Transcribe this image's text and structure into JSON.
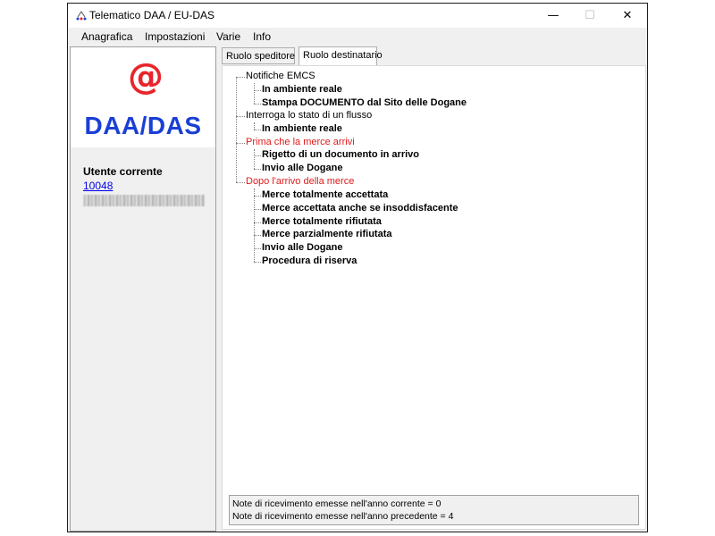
{
  "window": {
    "title": "Telematico DAA / EU-DAS",
    "controls": {
      "minimize": "—",
      "maximize": "☐",
      "close": "✕"
    }
  },
  "menu": [
    {
      "label": "Anagrafica"
    },
    {
      "label": "Impostazioni"
    },
    {
      "label": "Varie"
    },
    {
      "label": "Info"
    }
  ],
  "sidebar": {
    "logo_symbol": "@",
    "logo_text": "DAA/DAS",
    "user_label": "Utente corrente",
    "user_id": "10048"
  },
  "tabs": [
    {
      "label": "Ruolo speditore",
      "active": false
    },
    {
      "label": "Ruolo destinatario",
      "active": true
    }
  ],
  "tree": [
    {
      "label": "Notifiche EMCS",
      "color": "#000000",
      "children": [
        "In ambiente reale",
        "Stampa DOCUMENTO dal Sito delle Dogane"
      ]
    },
    {
      "label": "Interroga lo stato di un flusso",
      "color": "#000000",
      "children": [
        "In ambiente reale"
      ]
    },
    {
      "label": "Prima che la merce arrivi",
      "color": "#e01b1b",
      "children": [
        "Rigetto di un documento in arrivo",
        "Invio alle Dogane"
      ]
    },
    {
      "label": "Dopo l'arrivo della merce",
      "color": "#e01b1b",
      "children": [
        "Merce totalmente accettata",
        "Merce accettata anche se insoddisfacente",
        "Merce totalmente rifiutata",
        "Merce parzialmente rifiutata",
        "Invio alle Dogane",
        "Procedura di riserva"
      ]
    }
  ],
  "status": {
    "line1": "Note di ricevimento emesse nell'anno corrente = 0",
    "line2": "Note di ricevimento emesse nell'anno precedente = 4"
  },
  "colors": {
    "logo_red": "#e8242b",
    "logo_blue": "#1a3fd6",
    "tree_red": "#e01b1b"
  }
}
